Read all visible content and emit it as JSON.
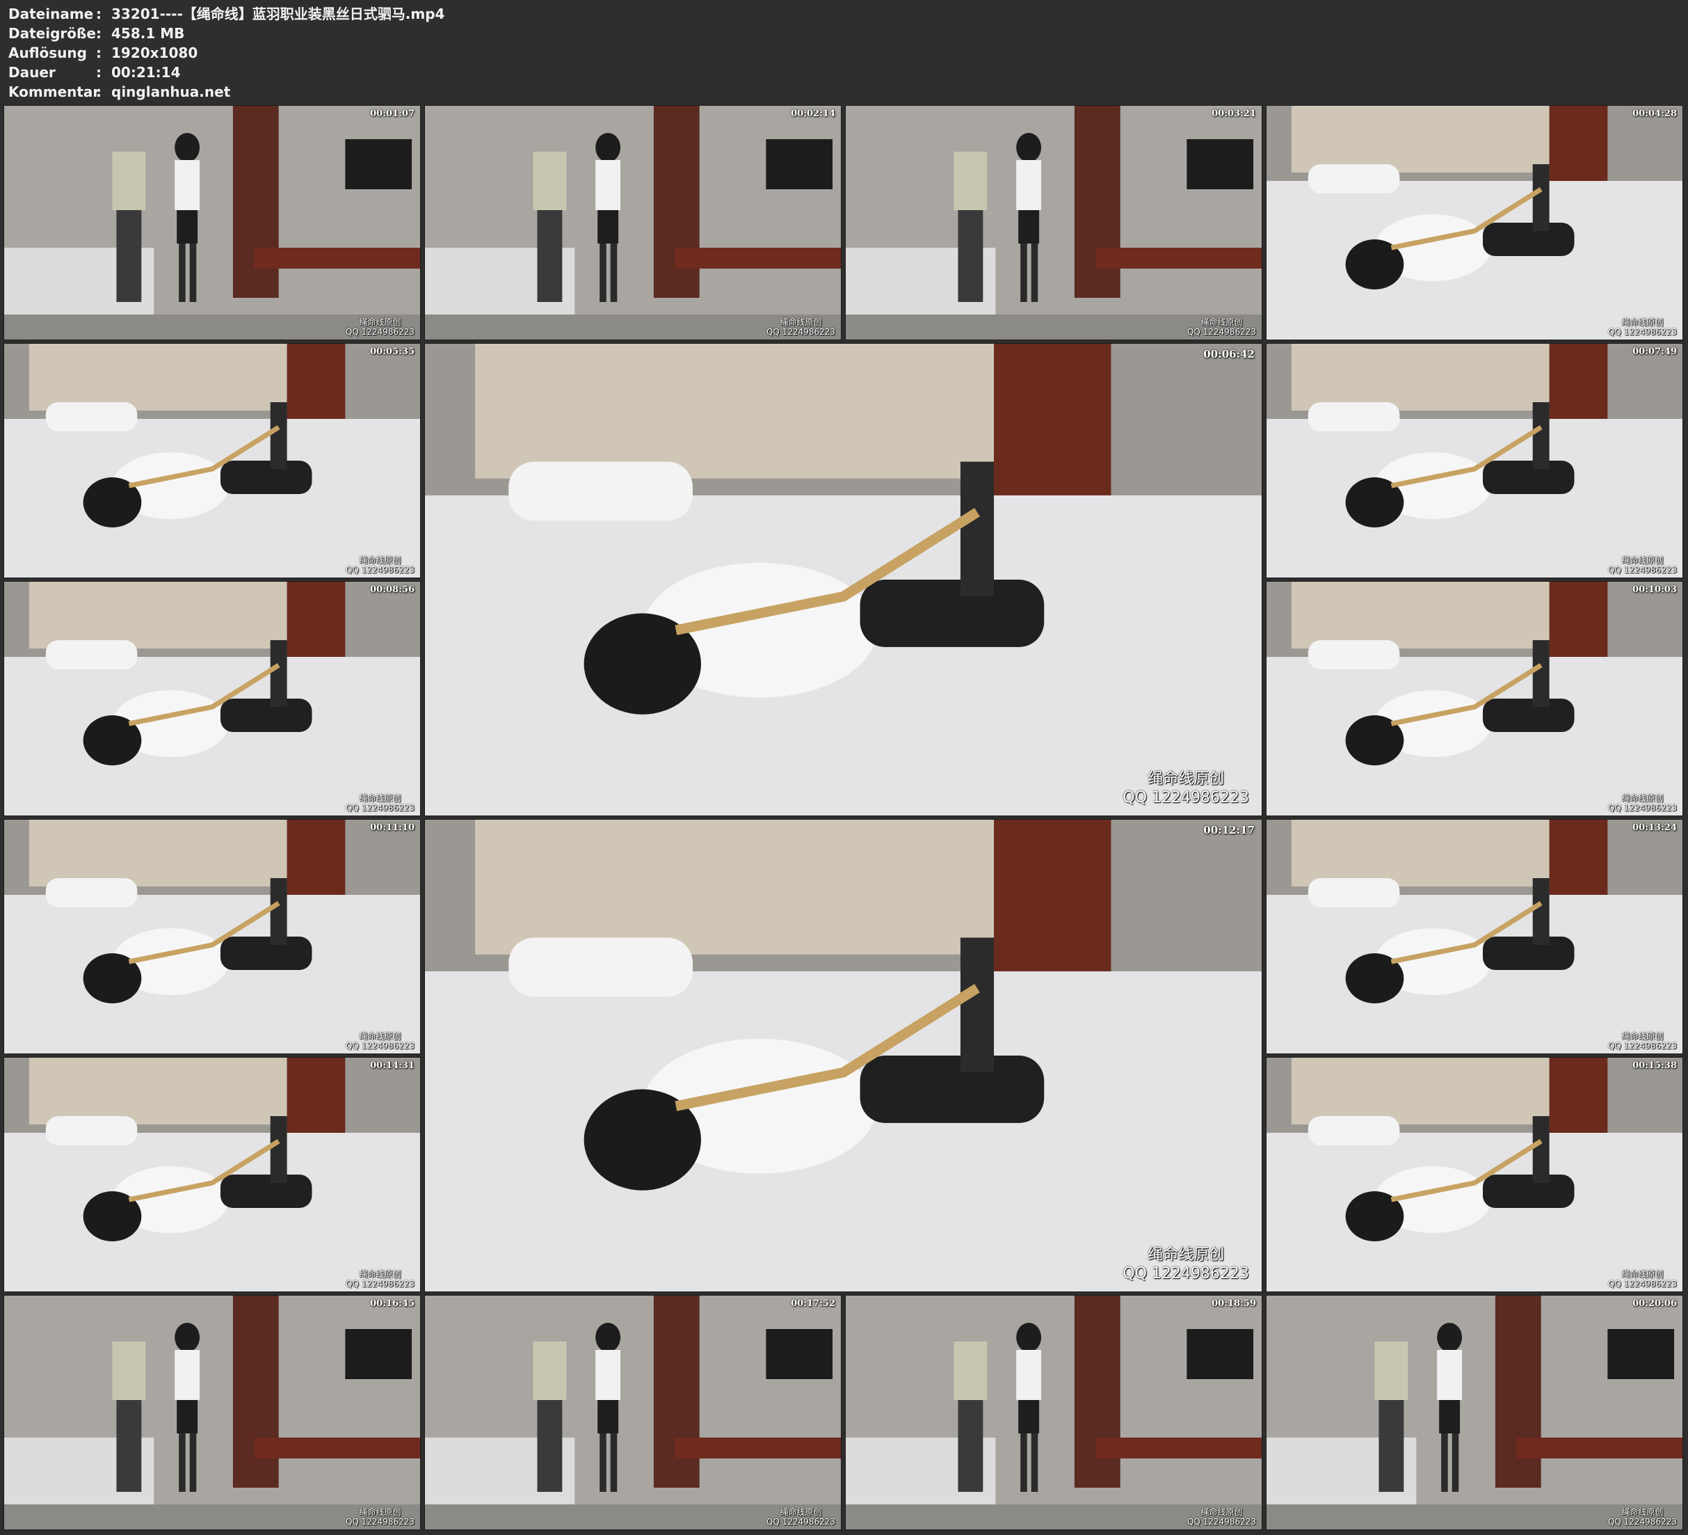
{
  "header": {
    "separator": ":",
    "rows": [
      {
        "key": "Dateiname",
        "value": "33201----【绳命线】蓝羽职业装黑丝日式驷马.mp4"
      },
      {
        "key": "Dateigröße",
        "value": "458.1 MB"
      },
      {
        "key": "Auflösung",
        "value": "1920x1080"
      },
      {
        "key": "Dauer",
        "value": "00:21:14"
      },
      {
        "key": "Kommentar",
        "value": "qinglanhua.net"
      }
    ]
  },
  "watermark": {
    "line1": "绳命线原创",
    "line2": "QQ 1224986223"
  },
  "thumbnails": [
    {
      "time": "00:01:07",
      "scene": "room"
    },
    {
      "time": "00:02:14",
      "scene": "room"
    },
    {
      "time": "00:03:21",
      "scene": "room"
    },
    {
      "time": "00:04:28",
      "scene": "bed"
    },
    {
      "time": "00:05:35",
      "scene": "bed"
    },
    {
      "time": "00:06:42",
      "scene": "bed"
    },
    {
      "time": "00:07:49",
      "scene": "bed"
    },
    {
      "time": "00:08:56",
      "scene": "bed"
    },
    {
      "time": "00:10:03",
      "scene": "bed"
    },
    {
      "time": "00:11:10",
      "scene": "bed"
    },
    {
      "time": "00:12:17",
      "scene": "bed"
    },
    {
      "time": "00:13:24",
      "scene": "bed"
    },
    {
      "time": "00:14:31",
      "scene": "bed"
    },
    {
      "time": "00:15:38",
      "scene": "bed"
    },
    {
      "time": "00:16:45",
      "scene": "room"
    },
    {
      "time": "00:17:52",
      "scene": "room"
    },
    {
      "time": "00:18:59",
      "scene": "room"
    },
    {
      "time": "00:20:06",
      "scene": "room"
    }
  ]
}
